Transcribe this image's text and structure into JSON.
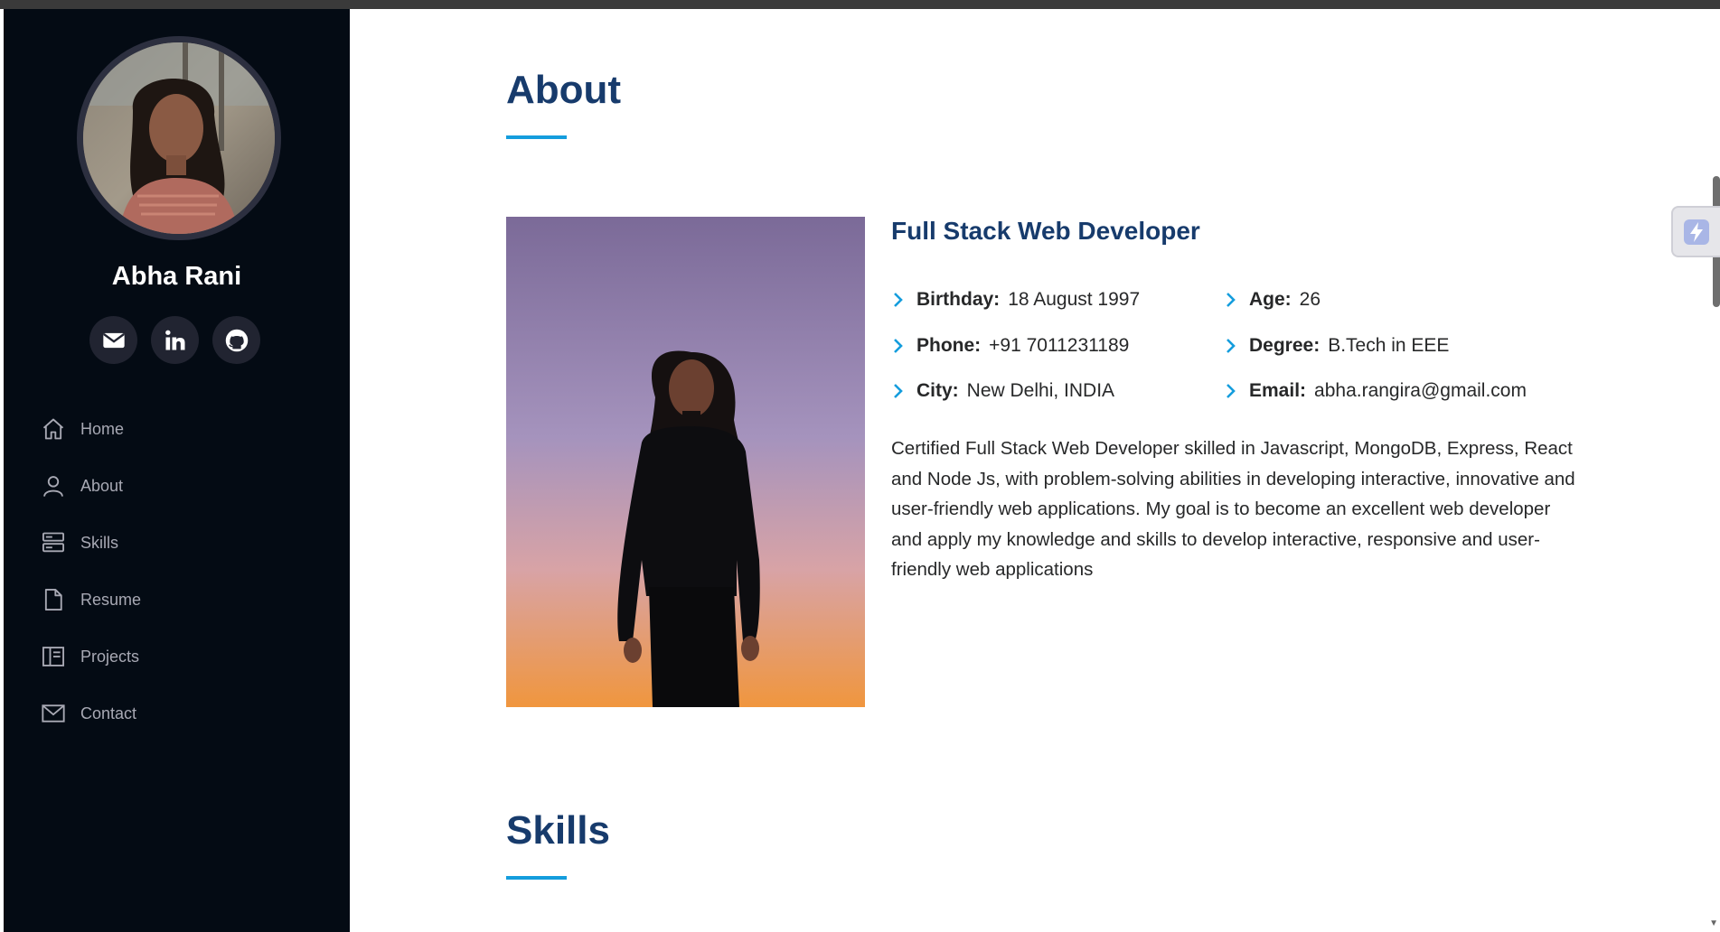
{
  "sidebar": {
    "profile_name": "Abha Rani",
    "socials": [
      {
        "icon": "envelope-icon"
      },
      {
        "icon": "linkedin-icon"
      },
      {
        "icon": "github-icon"
      }
    ],
    "nav": [
      {
        "label": "Home",
        "icon": "house-icon"
      },
      {
        "label": "About",
        "icon": "person-icon"
      },
      {
        "label": "Skills",
        "icon": "server-icon"
      },
      {
        "label": "Resume",
        "icon": "file-icon"
      },
      {
        "label": "Projects",
        "icon": "book-icon"
      },
      {
        "label": "Contact",
        "icon": "envelope-icon"
      }
    ]
  },
  "about": {
    "title": "About",
    "role": "Full Stack Web Developer",
    "details": [
      {
        "key": "Birthday:",
        "value": "18 August 1997"
      },
      {
        "key": "Age:",
        "value": "26"
      },
      {
        "key": "Phone:",
        "value": "+91 7011231189"
      },
      {
        "key": "Degree:",
        "value": "B.Tech in EEE"
      },
      {
        "key": "City:",
        "value": "New Delhi, INDIA"
      },
      {
        "key": "Email:",
        "value": "abha.rangira@gmail.com"
      }
    ],
    "bio": "Certified Full Stack Web Developer skilled in Javascript, MongoDB, Express, React and Node Js, with problem-solving abilities in developing interactive, innovative and user-friendly web applications. My goal is to become an excellent web developer and apply my knowledge and skills to develop interactive, responsive and user-friendly web applications"
  },
  "skills": {
    "title": "Skills"
  },
  "colors": {
    "sidebar_bg": "#040b14",
    "accent": "#149ddd",
    "heading": "#173b6c",
    "nav_text": "#a8a9b4"
  }
}
